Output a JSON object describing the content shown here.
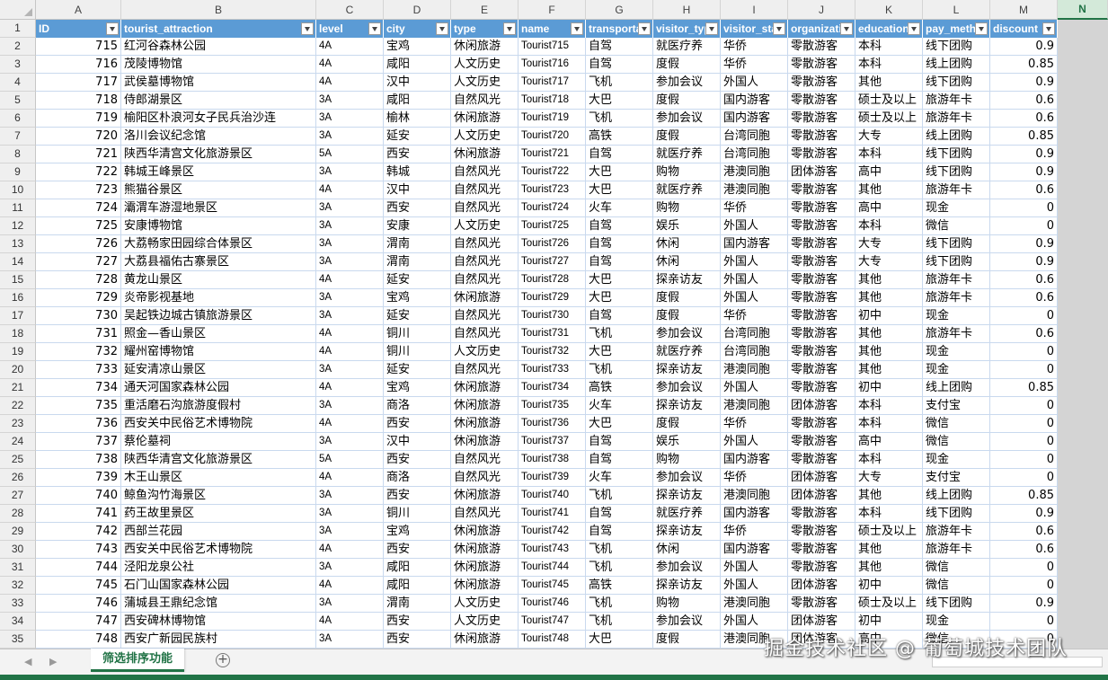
{
  "sheet": {
    "columns": [
      "A",
      "B",
      "C",
      "D",
      "E",
      "F",
      "G",
      "H",
      "I",
      "J",
      "K",
      "L",
      "M",
      "N"
    ],
    "selected_column": "N",
    "headers": [
      "ID",
      "tourist_attraction",
      "level",
      "city",
      "type",
      "name",
      "transporta",
      "visitor_typ",
      "visitor_sta",
      "organizati",
      "education",
      "pay_meth",
      "discount"
    ],
    "row_numbers": [
      "1",
      "2",
      "3",
      "4",
      "5",
      "6",
      "7",
      "8",
      "9",
      "10",
      "11",
      "12",
      "13",
      "14",
      "15",
      "16",
      "17",
      "18",
      "19",
      "20",
      "21",
      "22",
      "23",
      "24",
      "25",
      "26",
      "27",
      "28",
      "29",
      "30",
      "31",
      "32",
      "33",
      "34",
      "35"
    ],
    "rows": [
      [
        "715",
        "红河谷森林公园",
        "4A",
        "宝鸡",
        "休闲旅游",
        "Tourist715",
        "自驾",
        "就医疗养",
        "华侨",
        "零散游客",
        "本科",
        "线下团购",
        "0.9"
      ],
      [
        "716",
        "茂陵博物馆",
        "4A",
        "咸阳",
        "人文历史",
        "Tourist716",
        "自驾",
        "度假",
        "华侨",
        "零散游客",
        "本科",
        "线上团购",
        "0.85"
      ],
      [
        "717",
        "武侯墓博物馆",
        "4A",
        "汉中",
        "人文历史",
        "Tourist717",
        "飞机",
        "参加会议",
        "外国人",
        "零散游客",
        "其他",
        "线下团购",
        "0.9"
      ],
      [
        "718",
        "侍郎湖景区",
        "3A",
        "咸阳",
        "自然风光",
        "Tourist718",
        "大巴",
        "度假",
        "国内游客",
        "零散游客",
        "硕士及以上",
        "旅游年卡",
        "0.6"
      ],
      [
        "719",
        "榆阳区朴浪河女子民兵治沙连",
        "3A",
        "榆林",
        "休闲旅游",
        "Tourist719",
        "飞机",
        "参加会议",
        "国内游客",
        "零散游客",
        "硕士及以上",
        "旅游年卡",
        "0.6"
      ],
      [
        "720",
        "洛川会议纪念馆",
        "3A",
        "延安",
        "人文历史",
        "Tourist720",
        "高铁",
        "度假",
        "台湾同胞",
        "零散游客",
        "大专",
        "线上团购",
        "0.85"
      ],
      [
        "721",
        "陕西华清宫文化旅游景区",
        "5A",
        "西安",
        "休闲旅游",
        "Tourist721",
        "自驾",
        "就医疗养",
        "台湾同胞",
        "零散游客",
        "本科",
        "线下团购",
        "0.9"
      ],
      [
        "722",
        "韩城王峰景区",
        "3A",
        "韩城",
        "自然风光",
        "Tourist722",
        "大巴",
        "购物",
        "港澳同胞",
        "团体游客",
        "高中",
        "线下团购",
        "0.9"
      ],
      [
        "723",
        "熊猫谷景区",
        "4A",
        "汉中",
        "自然风光",
        "Tourist723",
        "大巴",
        "就医疗养",
        "港澳同胞",
        "零散游客",
        "其他",
        "旅游年卡",
        "0.6"
      ],
      [
        "724",
        "灞渭车游湿地景区",
        "3A",
        "西安",
        "自然风光",
        "Tourist724",
        "火车",
        "购物",
        "华侨",
        "零散游客",
        "高中",
        "现金",
        "0"
      ],
      [
        "725",
        "安康博物馆",
        "3A",
        "安康",
        "人文历史",
        "Tourist725",
        "自驾",
        "娱乐",
        "外国人",
        "零散游客",
        "本科",
        "微信",
        "0"
      ],
      [
        "726",
        "大荔畅家田园综合体景区",
        "3A",
        "渭南",
        "自然风光",
        "Tourist726",
        "自驾",
        "休闲",
        "国内游客",
        "零散游客",
        "大专",
        "线下团购",
        "0.9"
      ],
      [
        "727",
        "大荔县福佑古寨景区",
        "3A",
        "渭南",
        "自然风光",
        "Tourist727",
        "自驾",
        "休闲",
        "外国人",
        "零散游客",
        "大专",
        "线下团购",
        "0.9"
      ],
      [
        "728",
        "黄龙山景区",
        "4A",
        "延安",
        "自然风光",
        "Tourist728",
        "大巴",
        "探亲访友",
        "外国人",
        "零散游客",
        "其他",
        "旅游年卡",
        "0.6"
      ],
      [
        "729",
        "炎帝影视基地",
        "3A",
        "宝鸡",
        "休闲旅游",
        "Tourist729",
        "大巴",
        "度假",
        "外国人",
        "零散游客",
        "其他",
        "旅游年卡",
        "0.6"
      ],
      [
        "730",
        "吴起铁边城古镇旅游景区",
        "3A",
        "延安",
        "自然风光",
        "Tourist730",
        "自驾",
        "度假",
        "华侨",
        "零散游客",
        "初中",
        "现金",
        "0"
      ],
      [
        "731",
        "照金—香山景区",
        "4A",
        "铜川",
        "自然风光",
        "Tourist731",
        "飞机",
        "参加会议",
        "台湾同胞",
        "零散游客",
        "其他",
        "旅游年卡",
        "0.6"
      ],
      [
        "732",
        "耀州窑博物馆",
        "4A",
        "铜川",
        "人文历史",
        "Tourist732",
        "大巴",
        "就医疗养",
        "台湾同胞",
        "零散游客",
        "其他",
        "现金",
        "0"
      ],
      [
        "733",
        "延安清凉山景区",
        "3A",
        "延安",
        "自然风光",
        "Tourist733",
        "飞机",
        "探亲访友",
        "港澳同胞",
        "零散游客",
        "其他",
        "现金",
        "0"
      ],
      [
        "734",
        "通天河国家森林公园",
        "4A",
        "宝鸡",
        "休闲旅游",
        "Tourist734",
        "高铁",
        "参加会议",
        "外国人",
        "零散游客",
        "初中",
        "线上团购",
        "0.85"
      ],
      [
        "735",
        "重活磨石沟旅游度假村",
        "3A",
        "商洛",
        "休闲旅游",
        "Tourist735",
        "火车",
        "探亲访友",
        "港澳同胞",
        "团体游客",
        "本科",
        "支付宝",
        "0"
      ],
      [
        "736",
        "西安关中民俗艺术博物院",
        "4A",
        "西安",
        "休闲旅游",
        "Tourist736",
        "大巴",
        "度假",
        "华侨",
        "零散游客",
        "本科",
        "微信",
        "0"
      ],
      [
        "737",
        "蔡伦墓祠",
        "3A",
        "汉中",
        "休闲旅游",
        "Tourist737",
        "自驾",
        "娱乐",
        "外国人",
        "零散游客",
        "高中",
        "微信",
        "0"
      ],
      [
        "738",
        "陕西华清宫文化旅游景区",
        "5A",
        "西安",
        "自然风光",
        "Tourist738",
        "自驾",
        "购物",
        "国内游客",
        "零散游客",
        "本科",
        "现金",
        "0"
      ],
      [
        "739",
        "木王山景区",
        "4A",
        "商洛",
        "自然风光",
        "Tourist739",
        "火车",
        "参加会议",
        "华侨",
        "团体游客",
        "大专",
        "支付宝",
        "0"
      ],
      [
        "740",
        "鲸鱼沟竹海景区",
        "3A",
        "西安",
        "休闲旅游",
        "Tourist740",
        "飞机",
        "探亲访友",
        "港澳同胞",
        "团体游客",
        "其他",
        "线上团购",
        "0.85"
      ],
      [
        "741",
        "药王故里景区",
        "3A",
        "铜川",
        "自然风光",
        "Tourist741",
        "自驾",
        "就医疗养",
        "国内游客",
        "零散游客",
        "本科",
        "线下团购",
        "0.9"
      ],
      [
        "742",
        "西部兰花园",
        "3A",
        "宝鸡",
        "休闲旅游",
        "Tourist742",
        "自驾",
        "探亲访友",
        "华侨",
        "零散游客",
        "硕士及以上",
        "旅游年卡",
        "0.6"
      ],
      [
        "743",
        "西安关中民俗艺术博物院",
        "4A",
        "西安",
        "休闲旅游",
        "Tourist743",
        "飞机",
        "休闲",
        "国内游客",
        "零散游客",
        "其他",
        "旅游年卡",
        "0.6"
      ],
      [
        "744",
        "泾阳龙泉公社",
        "3A",
        "咸阳",
        "休闲旅游",
        "Tourist744",
        "飞机",
        "参加会议",
        "外国人",
        "零散游客",
        "其他",
        "微信",
        "0"
      ],
      [
        "745",
        "石门山国家森林公园",
        "4A",
        "咸阳",
        "休闲旅游",
        "Tourist745",
        "高铁",
        "探亲访友",
        "外国人",
        "团体游客",
        "初中",
        "微信",
        "0"
      ],
      [
        "746",
        "蒲城县王鼎纪念馆",
        "3A",
        "渭南",
        "人文历史",
        "Tourist746",
        "飞机",
        "购物",
        "港澳同胞",
        "零散游客",
        "硕士及以上",
        "线下团购",
        "0.9"
      ],
      [
        "747",
        "西安碑林博物馆",
        "4A",
        "西安",
        "人文历史",
        "Tourist747",
        "飞机",
        "参加会议",
        "外国人",
        "团体游客",
        "初中",
        "现金",
        "0"
      ],
      [
        "748",
        "西安广新园民族村",
        "3A",
        "西安",
        "休闲旅游",
        "Tourist748",
        "大巴",
        "度假",
        "港澳同胞",
        "团体游客",
        "高中",
        "微信",
        "0"
      ]
    ]
  },
  "tabs": {
    "active": "筛选排序功能",
    "add_symbol": "+",
    "prev": "◀",
    "next": "▶"
  },
  "watermark": "掘金技术社区 @ 葡萄城技术团队"
}
